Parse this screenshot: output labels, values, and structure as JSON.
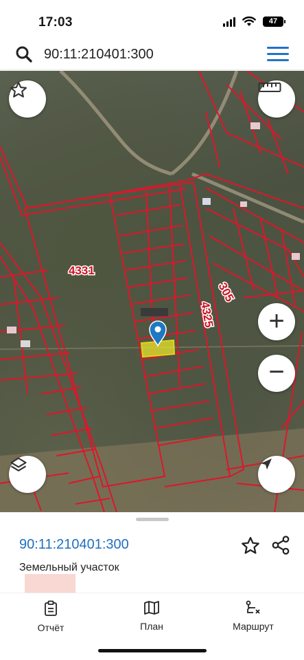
{
  "status_bar": {
    "time": "17:03",
    "battery": "47"
  },
  "search": {
    "value": "90:11:210401:300"
  },
  "map": {
    "labels": [
      {
        "text": "4331",
        "rotate": 0
      },
      {
        "text": "4325",
        "rotate": 80
      },
      {
        "text": "305",
        "rotate": 62
      }
    ],
    "buttons": {
      "favorite_icon": "star-icon",
      "ruler_icon": "ruler-icon",
      "zoom_in_label": "+",
      "zoom_out_label": "−",
      "layers_icon": "layers-icon",
      "locate_icon": "location-arrow-icon"
    },
    "colors": {
      "parcel_outline": "#e0152a",
      "selected_fill": "#e8e62a",
      "marker": "#1e79c2"
    }
  },
  "sheet": {
    "parcel_id": "90:11:210401:300",
    "parcel_type": "Земельный участок"
  },
  "tabbar": {
    "items": [
      {
        "label": "Отчёт",
        "icon": "report-icon"
      },
      {
        "label": "План",
        "icon": "map-icon"
      },
      {
        "label": "Маршрут",
        "icon": "route-icon"
      }
    ]
  }
}
